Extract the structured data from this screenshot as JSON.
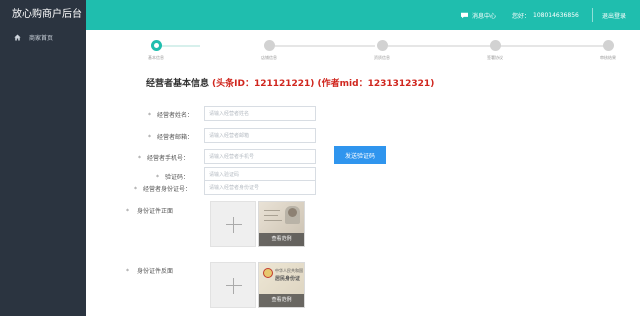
{
  "app": {
    "title": "放心购商户后台"
  },
  "sidebar": {
    "items": [
      {
        "label": "商家首页",
        "icon": "home-icon"
      }
    ]
  },
  "header": {
    "message_center": "消息中心",
    "account_label": "您好：",
    "account_value": "108014636856",
    "logout": "退出登录"
  },
  "steps": [
    {
      "label": "基本信息",
      "active": true
    },
    {
      "label": "店铺信息",
      "active": false
    },
    {
      "label": "资质信息",
      "active": false
    },
    {
      "label": "签署协议",
      "active": false
    },
    {
      "label": "审核结果",
      "active": false
    }
  ],
  "section": {
    "title": "经营者基本信息",
    "ids": "(头条ID：121121221) (作者mid：1231312321)"
  },
  "form": {
    "name": {
      "label": "经营者姓名：",
      "placeholder": "请输入经营者姓名"
    },
    "email": {
      "label": "经营者邮箱：",
      "placeholder": "请输入经营者邮箱"
    },
    "phone": {
      "label": "经营者手机号：",
      "placeholder": "请输入经营者手机号"
    },
    "code": {
      "label": "验证码：",
      "placeholder": "请输入验证码"
    },
    "id_number": {
      "label": "经营者身份证号：",
      "placeholder": "请输入经营者身份证号"
    },
    "send_code": "发送验证码",
    "required_mark": "*"
  },
  "uploads": {
    "front": {
      "label": "身份证件正面",
      "sample_caption": "查看范例"
    },
    "back": {
      "label": "身份证件反面",
      "sample_caption": "查看范例",
      "card_line1": "中华人民共和国",
      "card_line2": "居民身份证"
    }
  },
  "colors": {
    "teal": "#1fbeae",
    "sidebar": "#2b3440",
    "button_blue": "#2f95ee",
    "id_red": "#d0261e"
  }
}
